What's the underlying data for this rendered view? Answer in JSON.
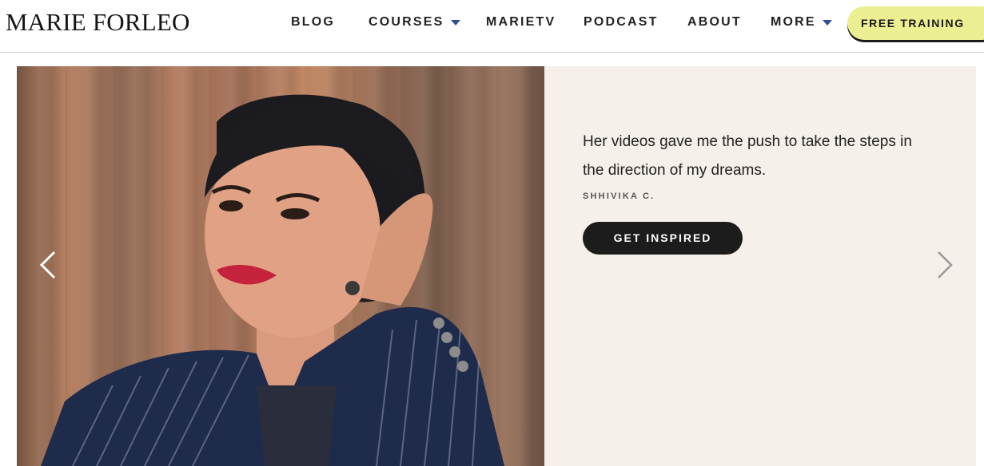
{
  "header": {
    "logo_text": "MARIE FORLEO",
    "nav": [
      {
        "label": "BLOG",
        "dropdown": false
      },
      {
        "label": "COURSES",
        "dropdown": true
      },
      {
        "label": "MARIETV",
        "dropdown": false
      },
      {
        "label": "PODCAST",
        "dropdown": false
      },
      {
        "label": "ABOUT",
        "dropdown": false
      },
      {
        "label": "MORE",
        "dropdown": true
      }
    ],
    "cta_label": "FREE TRAINING",
    "accent_color": "#ecee92",
    "caret_color": "#2f4f9a"
  },
  "carousel": {
    "quote": "Her videos gave me the push to take the steps in the direction of my dreams.",
    "author": "SHHIVIKA C.",
    "button_label": "GET INSPIRED",
    "prev_icon": "chevron-left-icon",
    "next_icon": "chevron-right-icon",
    "panel_color": "#f5f0ea"
  }
}
